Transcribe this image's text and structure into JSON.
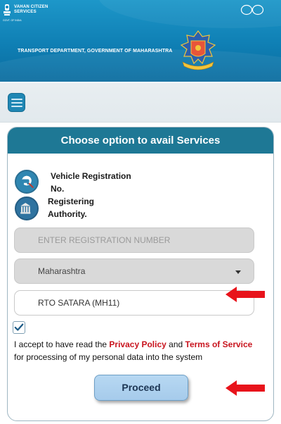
{
  "header": {
    "brand_line1": "VAHAN CITIZEN",
    "brand_line2": "SERVICES",
    "gov_tag": "GOVT. OF INDIA",
    "department": "TRANSPORT DEPARTMENT, GOVERNMENT OF MAHARASHTRA"
  },
  "card": {
    "title": "Choose option to avail Services",
    "option1": {
      "line1": "Vehicle Registration",
      "line2": "No.",
      "icon": "car-search-icon"
    },
    "option2": {
      "line1": "Registering",
      "line2": "Authority.",
      "icon": "building-icon"
    },
    "registration": {
      "placeholder": "ENTER REGISTRATION NUMBER",
      "value": ""
    },
    "state": {
      "value": "Maharashtra"
    },
    "rto": {
      "value": "RTO SATARA (MH11)"
    },
    "checkbox_checked": true,
    "consent": {
      "prefix": "I accept to have read the ",
      "privacy": "Privacy Policy",
      "and": " and ",
      "terms": "Terms of Service",
      "suffix": "for processing of my personal data into the system"
    },
    "proceed_label": "Proceed"
  },
  "colors": {
    "header": "#1588c0",
    "card_header": "#1e7895",
    "link_red": "#c8141e",
    "arrow_red": "#e8131b"
  }
}
